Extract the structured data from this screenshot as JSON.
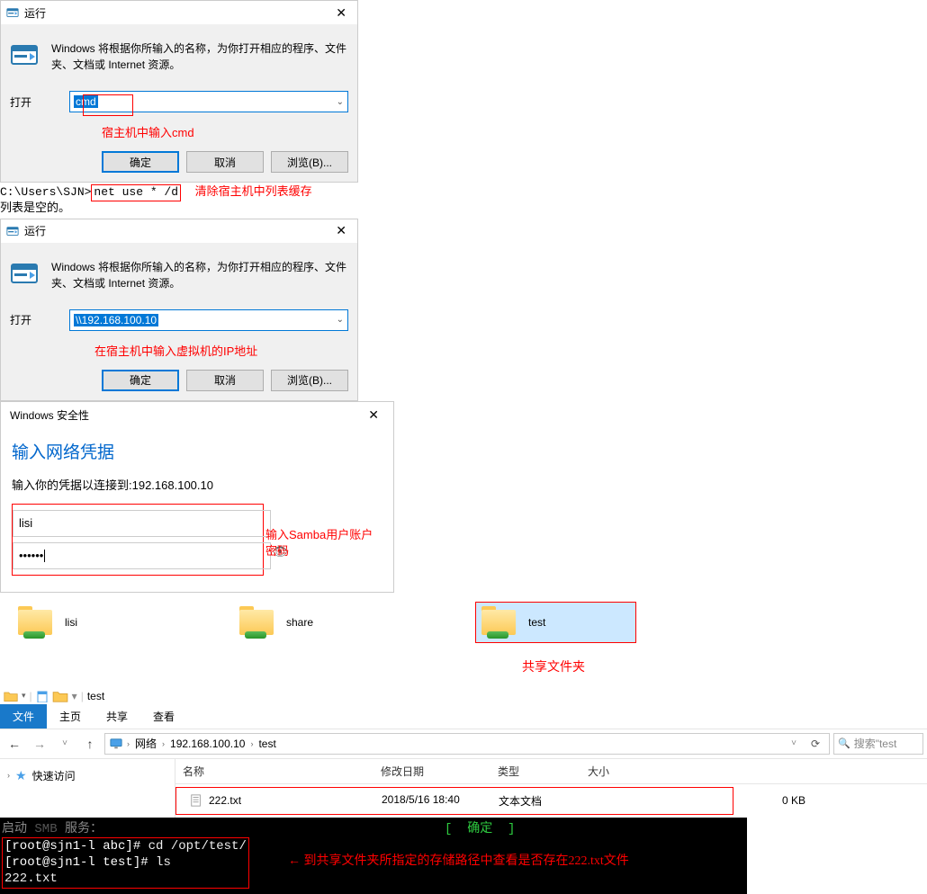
{
  "runDialog1": {
    "title": "运行",
    "desc": "Windows 将根据你所输入的名称，为你打开相应的程序、文件夹、文档或 Internet 资源。",
    "openLabel": "打开",
    "value": "cmd",
    "ok": "确定",
    "cancel": "取消",
    "browse": "浏览(B)...",
    "annotation": "宿主机中输入cmd"
  },
  "cmdBlock": {
    "prompt": "C:\\Users\\SJN>",
    "cmd": "net use * /d",
    "annot": "清除宿主机中列表缓存",
    "line2": "列表是空的。"
  },
  "runDialog2": {
    "title": "运行",
    "desc": "Windows 将根据你所输入的名称，为你打开相应的程序、文件夹、文档或 Internet 资源。",
    "openLabel": "打开",
    "value": "\\\\192.168.100.10",
    "ok": "确定",
    "cancel": "取消",
    "browse": "浏览(B)...",
    "annotation": "在宿主机中输入虚拟机的IP地址"
  },
  "security": {
    "title": "Windows 安全性",
    "heading": "输入网络凭据",
    "sub": "输入你的凭据以连接到:192.168.100.10",
    "user": "lisi",
    "pass": "••••••",
    "annot1": "输入Samba用户账户",
    "annot2": "密码"
  },
  "folders": {
    "f1": "lisi",
    "f2": "share",
    "f3": "test",
    "annot": "共享文件夹"
  },
  "explorer": {
    "titleTab": "test",
    "tabFile": "文件",
    "tabHome": "主页",
    "tabShare": "共享",
    "tabView": "查看",
    "bcNetwork": "网络",
    "bcIP": "192.168.100.10",
    "bcFolder": "test",
    "searchPlaceholder": "搜索\"test",
    "quickAccess": "快速访问",
    "cols": {
      "name": "名称",
      "date": "修改日期",
      "type": "类型",
      "size": "大小"
    },
    "file": {
      "name": "222.txt",
      "date": "2018/5/16 18:40",
      "type": "文本文档",
      "size": "0 KB"
    }
  },
  "terminal": {
    "line0a": "启动",
    "line0b": "服务：",
    "status": "[  确定  ]",
    "line1_prompt": "[root@sjn1-l abc]#",
    "line1_cmd": " cd /opt/test/",
    "line2_prompt": "[root@sjn1-l test]#",
    "line2_cmd": " ls",
    "line3": "222.txt",
    "annot_arrow": "←",
    "annot": "到共享文件夹所指定的存储路径中查看是否存在222.txt文件"
  }
}
